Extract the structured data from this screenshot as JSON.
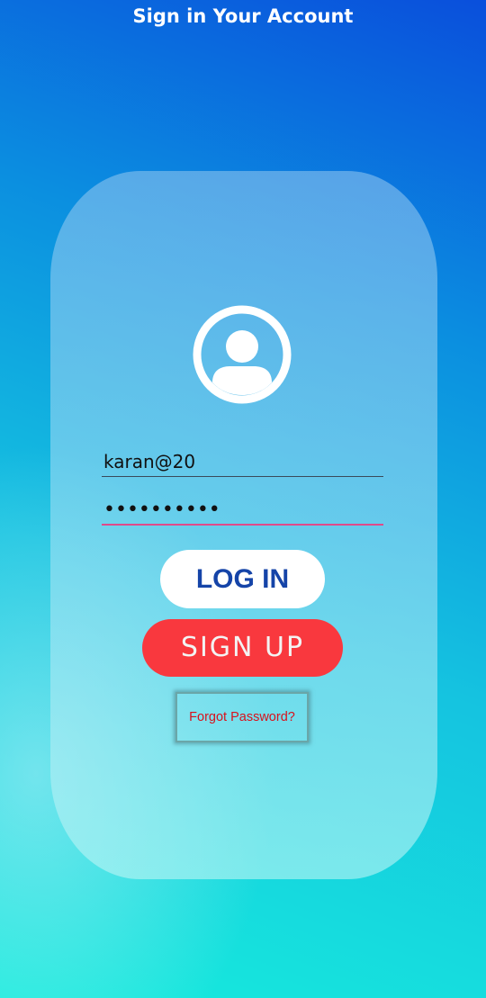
{
  "header": {
    "title": "Sign in Your Account"
  },
  "avatar": {
    "icon": "user-avatar-icon"
  },
  "login_form": {
    "email_value": "karan@20",
    "password_value": "••••••••••",
    "login_label": "LOG IN",
    "signup_label": "SIGN UP",
    "forgot_label": "Forgot Password?"
  },
  "colors": {
    "login_text": "#1544a8",
    "signup_bg": "#f9383e",
    "forgot_text": "#d8121c",
    "password_underline": "#e04a8a"
  }
}
